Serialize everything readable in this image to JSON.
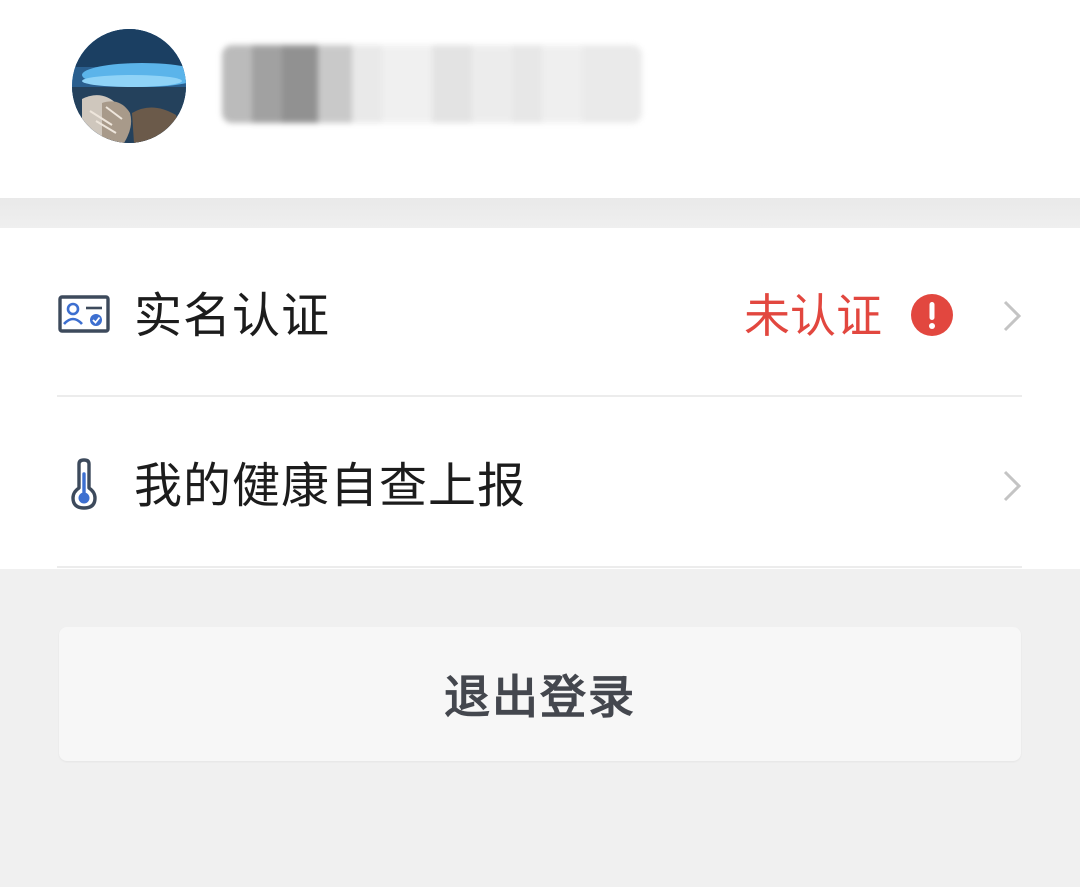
{
  "profile": {
    "avatar_alt": "avatar",
    "username": ""
  },
  "menu": {
    "items": [
      {
        "label": "实名认证",
        "icon": "id-card-icon",
        "status": "未认证",
        "status_color": "#e2473f",
        "status_icon": "alert-icon"
      },
      {
        "label": "我的健康自查上报",
        "icon": "thermometer-icon"
      }
    ]
  },
  "logout": {
    "label": "退出登录"
  },
  "colors": {
    "accent_red": "#e2473f",
    "text_primary": "#1c1c1c",
    "button_text": "#44474e",
    "background": "#f0f0f0"
  }
}
